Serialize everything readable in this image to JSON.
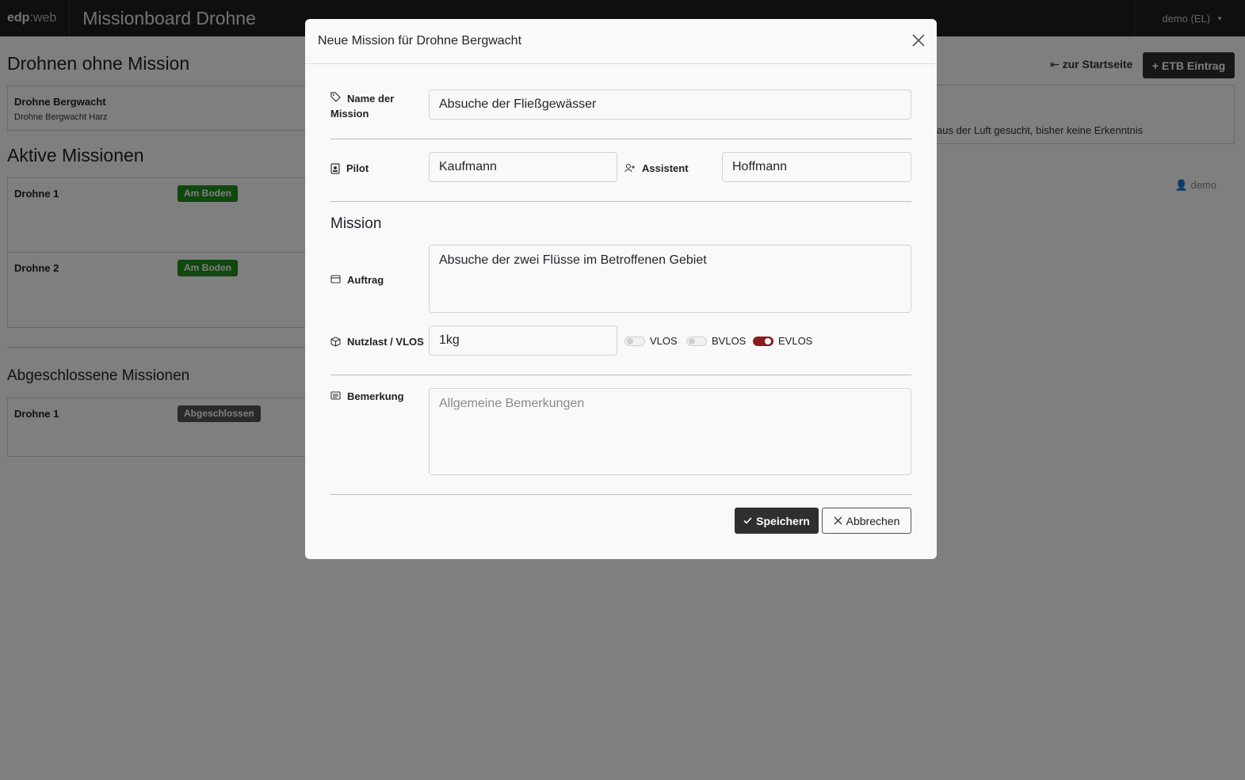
{
  "navbar": {
    "brand_bold": "edp",
    "brand_rest": ":web",
    "title": "Missionboard Drohne",
    "user": "demo (EL)"
  },
  "page": {
    "no_mission_heading": "Drohnen ohne Mission",
    "no_mission_drone": {
      "name": "Drohne Bergwacht",
      "sub": "Drohne Bergwacht Harz"
    },
    "active_heading": "Aktive Missionen",
    "active": [
      {
        "name": "Drohne 1",
        "status": "Am Boden"
      },
      {
        "name": "Drohne 2",
        "status": "Am Boden"
      }
    ],
    "completed_heading": "Abgeschlossene Missionen",
    "completed": [
      {
        "name": "Drohne 1",
        "status": "Abgeschlossen"
      }
    ],
    "start_link": "zur Startseite",
    "etb_button": "ETB Eintrag",
    "etb_user": "demo",
    "etb_text": "aus der Luft gesucht, bisher keine Erkenntnis"
  },
  "modal": {
    "title": "Neue Mission für Drohne Bergwacht",
    "name_label_1": "Name der",
    "name_label_2": "Mission",
    "name_value": "Absuche der Fließgewässer",
    "pilot_label": "Pilot",
    "pilot_value": "Kaufmann",
    "assistant_label": "Assistent",
    "assistant_value": "Hoffmann",
    "section_heading": "Mission",
    "task_label": "Auftrag",
    "task_value": "Absuche der zwei Flüsse im Betroffenen Gebiet",
    "payload_label": "Nutzlast / VLOS",
    "payload_value": "1kg",
    "toggles": [
      {
        "label": "VLOS",
        "on": false
      },
      {
        "label": "BVLOS",
        "on": false
      },
      {
        "label": "EVLOS",
        "on": true
      }
    ],
    "remark_label": "Bemerkung",
    "remark_placeholder": "Allgemeine Bemerkungen",
    "save_button": "Speichern",
    "cancel_button": "Abbrechen"
  },
  "colors": {
    "navbar": "#1e1e1e",
    "badge_green": "#1f8f1f",
    "toggle_on": "#8b1a1a",
    "button_dark": "#2f2f2f"
  }
}
